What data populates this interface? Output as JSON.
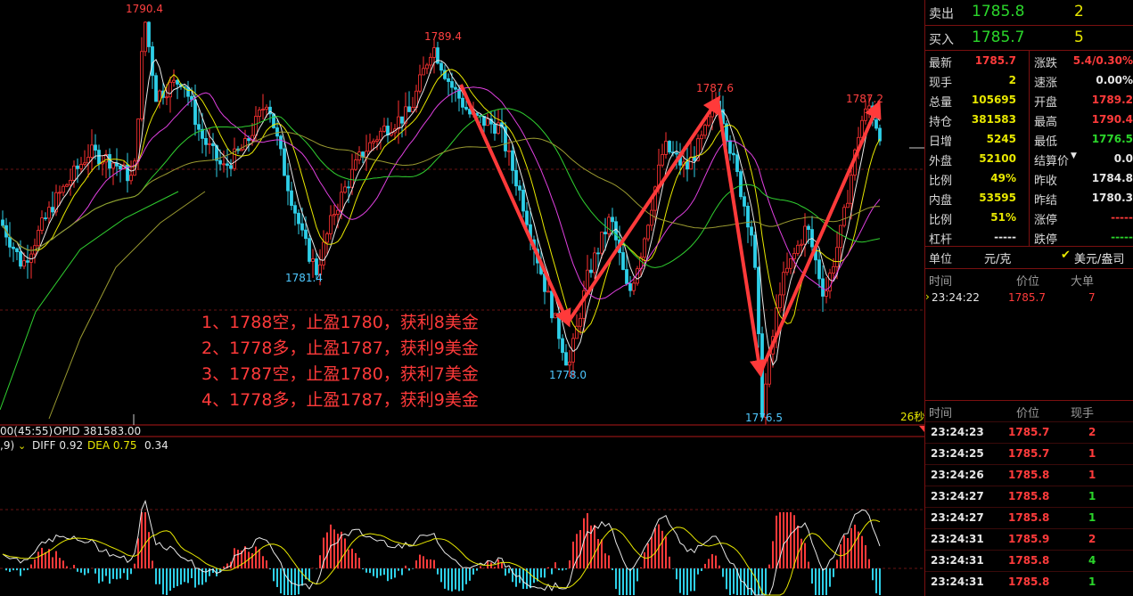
{
  "chart": {
    "price_labels": [
      {
        "text": "1790.4",
        "color": "#ff4040"
      },
      {
        "text": "1789.4",
        "color": "#ff4040"
      },
      {
        "text": "1787.6",
        "color": "#ff4040"
      },
      {
        "text": "1787.2",
        "color": "#ff4040"
      },
      {
        "text": "1781.4",
        "color": "#4fc8ff"
      },
      {
        "text": "1778.0",
        "color": "#4fc8ff"
      },
      {
        "text": "1776.5",
        "color": "#4fc8ff"
      }
    ],
    "annotations": [
      "1、1788空，止盈1780，获利8美金",
      "2、1778多，止盈1787，获利9美金",
      "3、1787空，止盈1780，获利7美金",
      "4、1778多，止盈1787，获利9美金"
    ],
    "countdown": "26秒",
    "status_line": {
      "opid_prefix": "00(45:55)",
      "opid": "OPID 381583.00"
    },
    "macd_line": {
      "prefix": ",9)",
      "diff": "DIFF 0.92",
      "dea": "DEA 0.75",
      "macd": "0.34"
    }
  },
  "quote": {
    "sell": {
      "label": "卖出",
      "price": "1785.8",
      "qty": "2"
    },
    "buy": {
      "label": "买入",
      "price": "1785.7",
      "qty": "5"
    },
    "stats_left": [
      {
        "label": "最新",
        "value": "1785.7",
        "color": "red"
      },
      {
        "label": "现手",
        "value": "2",
        "color": "yellow"
      },
      {
        "label": "总量",
        "value": "105695",
        "color": "yellow"
      },
      {
        "label": "持仓",
        "value": "381583",
        "color": "yellow"
      },
      {
        "label": "日增",
        "value": "5245",
        "color": "yellow"
      },
      {
        "label": "外盘",
        "value": "52100",
        "color": "yellow"
      },
      {
        "label": "比例",
        "value": "49%",
        "color": "yellow"
      },
      {
        "label": "内盘",
        "value": "53595",
        "color": "yellow"
      },
      {
        "label": "比例",
        "value": "51%",
        "color": "yellow"
      },
      {
        "label": "杠杆",
        "value": "-----",
        "color": "white"
      }
    ],
    "stats_right": [
      {
        "label": "涨跌",
        "value": "5.4/0.30%",
        "color": "red"
      },
      {
        "label": "速涨",
        "value": "0.00%",
        "color": "white"
      },
      {
        "label": "开盘",
        "value": "1789.2",
        "color": "red"
      },
      {
        "label": "最高",
        "value": "1790.4",
        "color": "red"
      },
      {
        "label": "最低",
        "value": "1776.5",
        "color": "green"
      },
      {
        "label": "结算价",
        "value": "0.0",
        "color": "white"
      },
      {
        "label": "昨收",
        "value": "1784.8",
        "color": "white"
      },
      {
        "label": "昨结",
        "value": "1780.3",
        "color": "white"
      },
      {
        "label": "涨停",
        "value": "-----",
        "color": "red"
      },
      {
        "label": "跌停",
        "value": "-----",
        "color": "green"
      }
    ],
    "unit": {
      "label": "单位",
      "value": "元/克",
      "check_label": "美元/盎司"
    },
    "big_orders": {
      "headers": [
        "时间",
        "价位",
        "大单"
      ],
      "rows": [
        {
          "time": "23:24:22",
          "price": "1785.7",
          "qty": "7"
        }
      ]
    },
    "ticks": {
      "headers": [
        "时间",
        "价位",
        "现手"
      ],
      "rows": [
        {
          "time": "23:24:23",
          "price": "1785.7",
          "qty": "2",
          "qcolor": "red"
        },
        {
          "time": "23:24:25",
          "price": "1785.7",
          "qty": "1",
          "qcolor": "red"
        },
        {
          "time": "23:24:26",
          "price": "1785.8",
          "qty": "1",
          "qcolor": "red"
        },
        {
          "time": "23:24:27",
          "price": "1785.8",
          "qty": "1",
          "qcolor": "green"
        },
        {
          "time": "23:24:27",
          "price": "1785.8",
          "qty": "1",
          "qcolor": "green"
        },
        {
          "time": "23:24:31",
          "price": "1785.9",
          "qty": "2",
          "qcolor": "red"
        },
        {
          "time": "23:24:31",
          "price": "1785.8",
          "qty": "4",
          "qcolor": "green"
        },
        {
          "time": "23:24:31",
          "price": "1785.8",
          "qty": "1",
          "qcolor": "green"
        }
      ]
    }
  }
}
